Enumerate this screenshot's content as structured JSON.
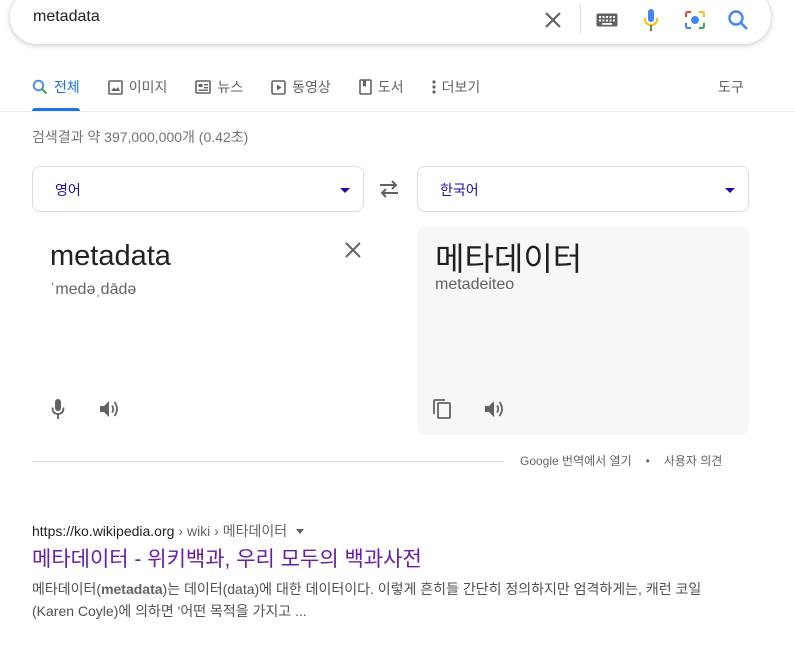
{
  "search": {
    "query": "metadata"
  },
  "tabs": [
    {
      "label": "전체",
      "icon": "search-icon"
    },
    {
      "label": "이미지",
      "icon": "image-icon"
    },
    {
      "label": "뉴스",
      "icon": "news-icon"
    },
    {
      "label": "동영상",
      "icon": "video-icon"
    },
    {
      "label": "도서",
      "icon": "book-icon"
    },
    {
      "label": "더보기",
      "icon": "more-vert-icon"
    }
  ],
  "tools_label": "도구",
  "stats": "검색결과 약 397,000,000개 (0.42초)",
  "translate": {
    "source_lang": "영어",
    "target_lang": "한국어",
    "source_text": "metadata",
    "source_phonetic": "ˈmedəˌdādə",
    "target_text": "메타데이터",
    "target_romanization": "metadeiteo",
    "footer_open": "Google 번역에서 열기",
    "footer_dot": "•",
    "footer_feedback": "사용자 의견"
  },
  "result": {
    "domain": "https://ko.wikipedia.org",
    "path": "› wiki › 메타데이터",
    "title": "메타데이터 - 위키백과, 우리 모두의 백과사전",
    "snippet_pre": "메타데이터(",
    "snippet_bold": "metadata",
    "snippet_post": ")는 데이터(data)에 대한 데이터이다. 이렇게 흔히들 간단히 정의하지만 엄격하게는, 캐런 코일(Karen Coyle)에 의하면 '어떤 목적을 가지고 ..."
  },
  "colors": {
    "accent": "#1a73e8",
    "link_visited": "#681da8",
    "lang_label": "#1a0dab"
  }
}
